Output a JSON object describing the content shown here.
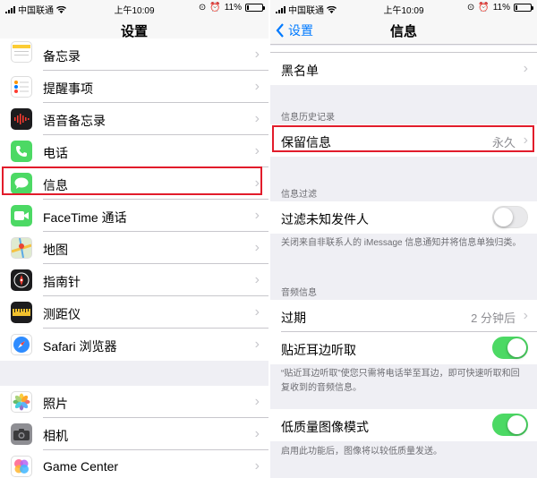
{
  "status": {
    "carrier": "中国联通",
    "time": "上午10:09",
    "battery": "11%",
    "battery_level": 0.11
  },
  "left": {
    "title": "设置",
    "items": [
      {
        "label": "备忘录",
        "icon": "notes-icon",
        "color": "#ffffff"
      },
      {
        "label": "提醒事项",
        "icon": "reminders-icon",
        "color": "#ffffff"
      },
      {
        "label": "语音备忘录",
        "icon": "voice-memos-icon",
        "color": "#1c1c1e"
      },
      {
        "label": "电话",
        "icon": "phone-icon",
        "color": "#4cd964"
      },
      {
        "label": "信息",
        "icon": "messages-icon",
        "color": "#4cd964"
      },
      {
        "label": "FaceTime 通话",
        "icon": "facetime-icon",
        "color": "#4cd964"
      },
      {
        "label": "地图",
        "icon": "maps-icon",
        "color": "#ffffff"
      },
      {
        "label": "指南针",
        "icon": "compass-icon",
        "color": "#1c1c1e"
      },
      {
        "label": "测距仪",
        "icon": "measure-icon",
        "color": "#1c1c1e"
      },
      {
        "label": "Safari 浏览器",
        "icon": "safari-icon",
        "color": "#ffffff"
      },
      {
        "label": "照片",
        "icon": "photos-icon",
        "color": "#ffffff"
      },
      {
        "label": "相机",
        "icon": "camera-icon",
        "color": "#8e8e93"
      },
      {
        "label": "Game Center",
        "icon": "game-center-icon",
        "color": "#ffffff"
      }
    ]
  },
  "right": {
    "back_label": "设置",
    "title": "信息",
    "blacklist": "黑名单",
    "history_header": "信息历史记录",
    "keep_messages": {
      "label": "保留信息",
      "value": "永久"
    },
    "filter_header": "信息过滤",
    "filter_unknown": {
      "label": "过滤未知发件人",
      "on": false
    },
    "filter_footer": "关闭来自非联系人的 iMessage 信息通知并将信息单独归类。",
    "audio_header": "音频信息",
    "expire": {
      "label": "过期",
      "value": "2 分钟后"
    },
    "raise_to_listen": {
      "label": "贴近耳边听取",
      "on": true
    },
    "raise_footer": "“贴近耳边听取”使您只需将电话举至耳边，即可快速听取和回复收到的音频信息。",
    "low_quality": {
      "label": "低质量图像模式",
      "on": true
    },
    "low_quality_footer": "启用此功能后，图像将以较低质量发送。"
  },
  "colors": {
    "accent": "#007aff",
    "toggle_on": "#4cd964",
    "highlight": "#e21c2b"
  }
}
